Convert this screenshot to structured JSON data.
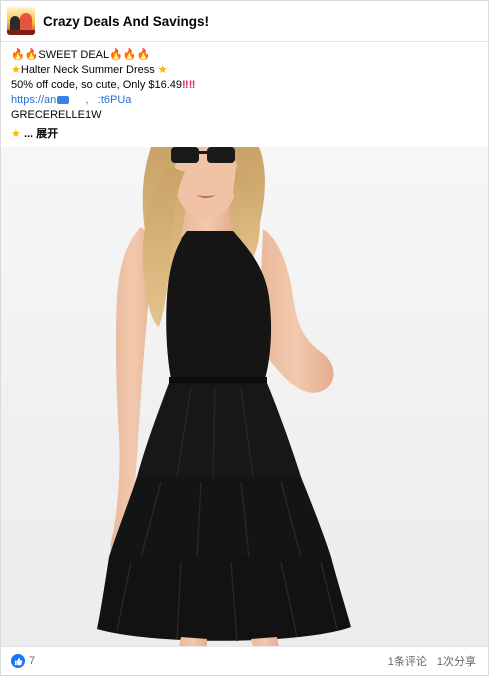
{
  "page": {
    "name": "Crazy Deals And Savings!"
  },
  "post": {
    "line1_text": "SWEET DEAL",
    "line2_text": "Halter Neck Summer Dress",
    "line3_text": "50% off code, so cute, Only $16.49",
    "link_start": "https://an",
    "link_mid": ",",
    "link_end": ":t6PUa",
    "code": "GRECERELLE1W",
    "more_dots": "...",
    "more_label": "展开"
  },
  "image": {
    "description_icon": "woman-in-black-halter-dress-photo"
  },
  "footer": {
    "reactions_count": "7",
    "comments": "1条评论",
    "shares": "1次分享"
  },
  "icons": {
    "flame": "flame-icon",
    "star": "star-icon",
    "double_exclamation": "double-exclamation-icon",
    "like": "like-icon"
  },
  "colors": {
    "link": "#216fdb",
    "like": "#1877f2",
    "flame": "#f0541e",
    "star": "#f5b400",
    "dress": "#151515"
  }
}
